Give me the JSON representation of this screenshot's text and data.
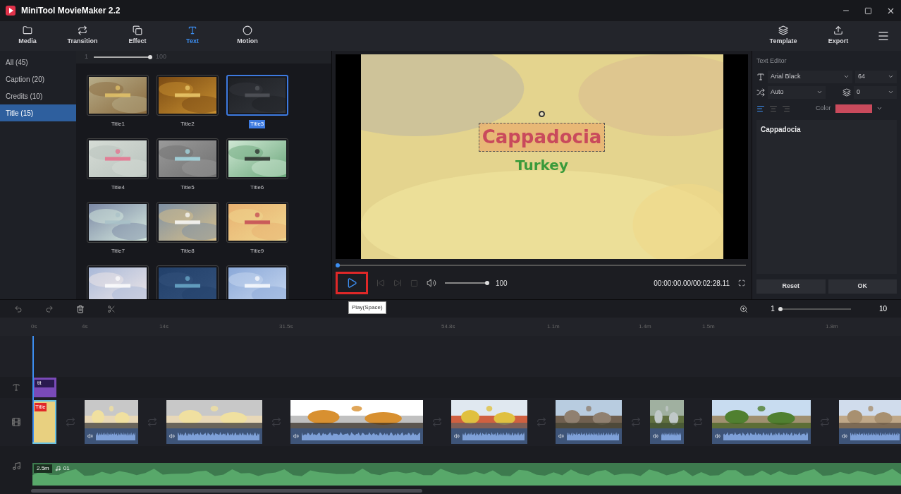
{
  "window": {
    "title": "MiniTool MovieMaker 2.2"
  },
  "toolbar": {
    "tabs": [
      {
        "kind": "media",
        "label": "Media",
        "selected": false
      },
      {
        "kind": "transition",
        "label": "Transition",
        "selected": false
      },
      {
        "kind": "effect",
        "label": "Effect",
        "selected": false
      },
      {
        "kind": "text",
        "label": "Text",
        "selected": true
      },
      {
        "kind": "motion",
        "label": "Motion",
        "selected": false
      }
    ],
    "actions": [
      {
        "kind": "template",
        "label": "Template"
      },
      {
        "kind": "export",
        "label": "Export"
      }
    ]
  },
  "categories": [
    {
      "label": "All (45)",
      "selected": false
    },
    {
      "label": "Caption (20)",
      "selected": false
    },
    {
      "label": "Credits (10)",
      "selected": false
    },
    {
      "label": "Title (15)",
      "selected": true
    }
  ],
  "size_slider": {
    "min": "1",
    "max": "100",
    "level": 1
  },
  "templates": [
    {
      "label": "Title1",
      "selected": false
    },
    {
      "label": "Title2",
      "selected": false
    },
    {
      "label": "Title3",
      "selected": true
    },
    {
      "label": "Title4",
      "selected": false
    },
    {
      "label": "Title5",
      "selected": false
    },
    {
      "label": "Title6",
      "selected": false
    },
    {
      "label": "Title7",
      "selected": false
    },
    {
      "label": "Title8",
      "selected": false
    },
    {
      "label": "Title9",
      "selected": false
    },
    {
      "selected": false
    },
    {
      "selected": false
    },
    {
      "selected": false
    }
  ],
  "preview": {
    "title": "Cappadocia",
    "subtitle": "Turkey",
    "progress": {
      "level": 0
    },
    "volume": {
      "level": 1,
      "reading": "100"
    },
    "time": "00:00:00.00/00:02:28.11",
    "tooltip": "Play(Space)"
  },
  "text_editor": {
    "title": "Text Editor",
    "font": "Arial Black",
    "size": "64",
    "spacing": "Auto",
    "line_spacing": "0",
    "color_label": "Color",
    "color": "#c94a5c",
    "align": [
      {
        "selected": true
      },
      {
        "selected": false
      },
      {
        "selected": false
      }
    ],
    "text": "Cappadocia",
    "buttons": [
      "Reset",
      "OK"
    ]
  },
  "timeline": {
    "zoom": {
      "min": "1",
      "max": "10",
      "level": 0
    },
    "ruler": [
      "0s",
      "4s",
      "14s",
      "31.5s",
      "54.8s",
      "1.1m",
      "1.4m",
      "1.5m",
      "1.8m"
    ],
    "text_clip": "tit",
    "clips": [
      {
        "kind": "title",
        "label": "Title"
      },
      {
        "kind": "transition"
      },
      {
        "kind": "video"
      },
      {
        "kind": "transition"
      },
      {
        "kind": "video"
      },
      {
        "kind": "transition"
      },
      {
        "kind": "video"
      },
      {
        "kind": "transition"
      },
      {
        "kind": "video"
      },
      {
        "kind": "transition"
      },
      {
        "kind": "video"
      },
      {
        "kind": "transition"
      },
      {
        "kind": "video"
      },
      {
        "kind": "transition"
      },
      {
        "kind": "video"
      },
      {
        "kind": "transition"
      },
      {
        "kind": "video"
      }
    ],
    "music": {
      "duration": "2.5m",
      "name": "01"
    }
  }
}
